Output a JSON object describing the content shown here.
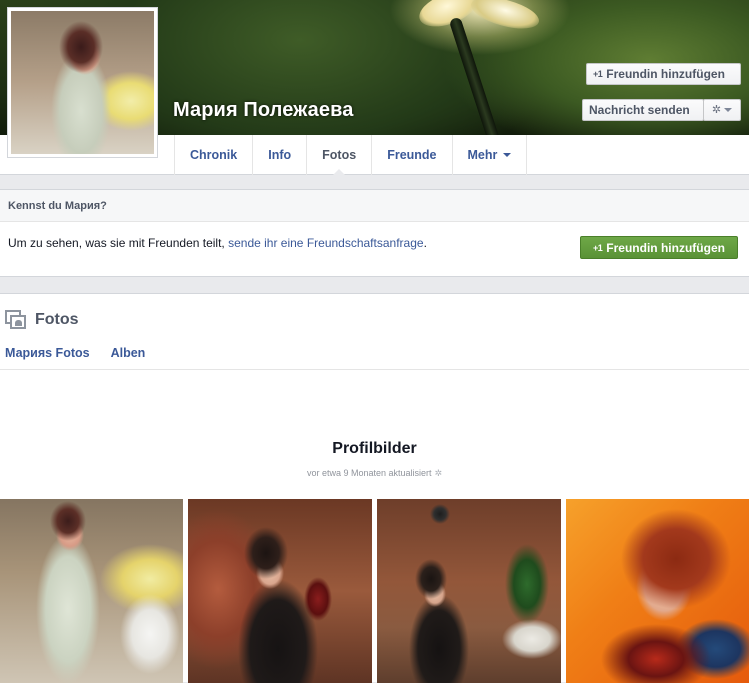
{
  "profile": {
    "name": "Мария Полежаева",
    "add_friend_label": "Freundin hinzufügen",
    "add_friend_prefix": "+1",
    "message_label": "Nachricht senden"
  },
  "tabs": [
    {
      "label": "Chronik"
    },
    {
      "label": "Info"
    },
    {
      "label": "Fotos",
      "active": true
    },
    {
      "label": "Freunde"
    },
    {
      "label": "Mehr"
    }
  ],
  "know": {
    "header": "Kennst du Мария?",
    "text_before": "Um zu sehen, was sie mit Freunden teilt, ",
    "link": "sende ihr eine Freundschaftsanfrage",
    "text_after": ".",
    "button_label": "Freundin hinzufügen",
    "button_prefix": "+1"
  },
  "photos": {
    "title": "Fotos",
    "nav": [
      "Марияs Fotos",
      "Alben"
    ],
    "album_title": "Profilbilder",
    "album_subtitle": "vor etwa 9 Monaten aktualisiert"
  },
  "colors": {
    "link": "#3b5998",
    "green_button": "#5a9236",
    "page_bg": "#e9eaed"
  }
}
